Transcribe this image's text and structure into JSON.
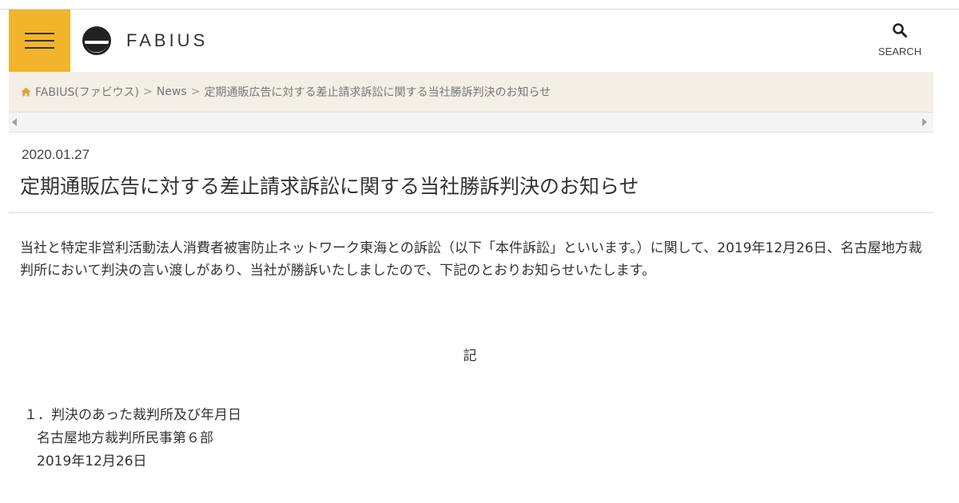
{
  "header": {
    "menu_icon": "hamburger-menu-icon",
    "logo_icon": "fabius-logo-mark",
    "logo_text": "FABIUS",
    "search_icon": "search-icon",
    "search_label": "SEARCH",
    "menu_color": "#f2b42d"
  },
  "breadcrumb": {
    "home_icon": "home-icon",
    "items": [
      "FABIUS(ファビウス)",
      "News",
      "定期通販広告に対する差止請求訴訟に関する当社勝訴判決のお知らせ"
    ],
    "separator": ">",
    "background": "#f3efe6"
  },
  "article": {
    "date": "2020.01.27",
    "title": "定期通販広告に対する差止請求訴訟に関する当社勝訴判決のお知らせ",
    "body": "当社と特定非営利活動法人消費者被害防止ネットワーク東海との訴訟（以下「本件訴訟」といいます。）に関して、2019年12月26日、名古屋地方裁判所において判決の言い渡しがあり、当社が勝訴いたしましたので、下記のとおりお知らせいたします。",
    "ki": "記",
    "item1": {
      "heading": "１．判決のあった裁判所及び年月日",
      "court": "名古屋地方裁判所民事第６部",
      "date": "2019年12月26日"
    }
  }
}
